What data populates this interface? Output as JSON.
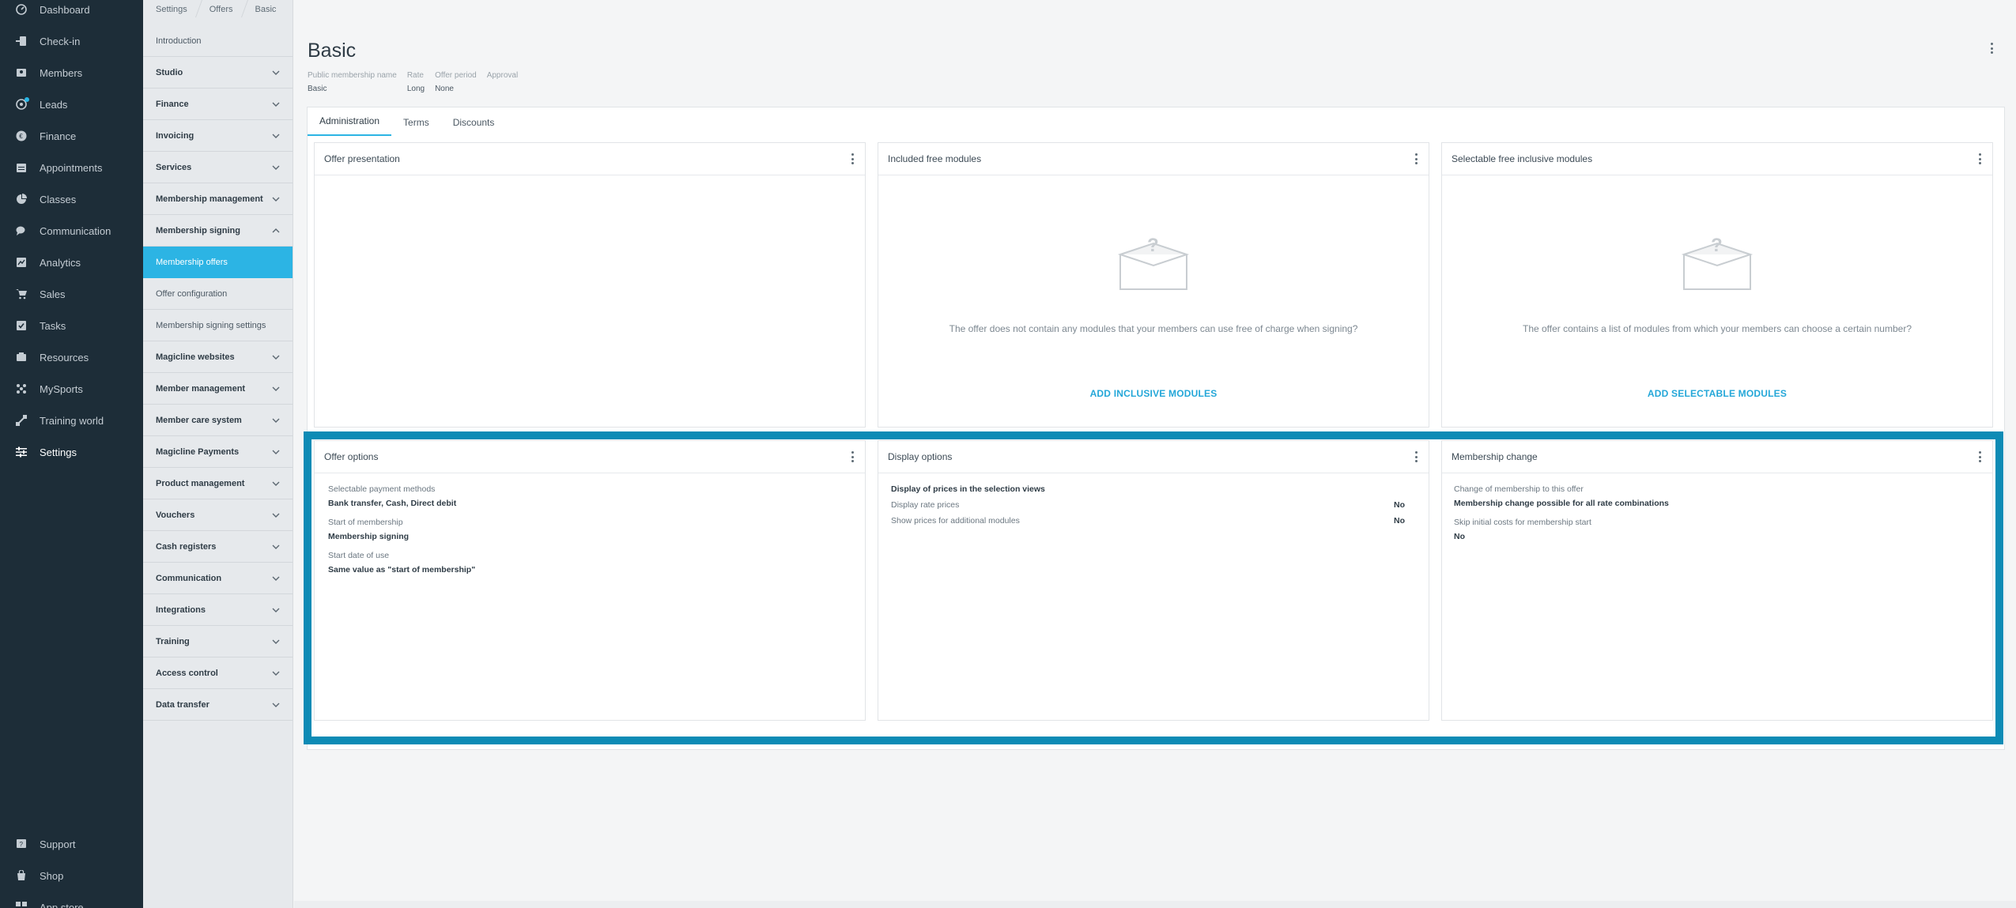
{
  "app_nav": {
    "items": [
      {
        "label": "Dashboard",
        "icon": "dashboard-icon"
      },
      {
        "label": "Check-in",
        "icon": "check-in-icon"
      },
      {
        "label": "Members",
        "icon": "members-icon"
      },
      {
        "label": "Leads",
        "icon": "leads-icon"
      },
      {
        "label": "Finance",
        "icon": "finance-icon"
      },
      {
        "label": "Appointments",
        "icon": "calendar-icon"
      },
      {
        "label": "Classes",
        "icon": "classes-icon"
      },
      {
        "label": "Communication",
        "icon": "chat-icon"
      },
      {
        "label": "Analytics",
        "icon": "analytics-icon"
      },
      {
        "label": "Sales",
        "icon": "cart-icon"
      },
      {
        "label": "Tasks",
        "icon": "tasks-icon"
      },
      {
        "label": "Resources",
        "icon": "resources-icon"
      },
      {
        "label": "MySports",
        "icon": "mysports-icon"
      },
      {
        "label": "Training world",
        "icon": "training-icon"
      },
      {
        "label": "Settings",
        "icon": "settings-sliders-icon"
      }
    ],
    "bottom_items": [
      {
        "label": "Support",
        "icon": "support-icon"
      },
      {
        "label": "Shop",
        "icon": "shop-icon"
      },
      {
        "label": "App store",
        "icon": "app-store-icon"
      }
    ],
    "active": "Settings"
  },
  "breadcrumb": [
    "Settings",
    "Offers",
    "Basic"
  ],
  "sub_nav": {
    "items": [
      {
        "label": "Introduction",
        "style": "plain"
      },
      {
        "label": "Studio",
        "style": "bold",
        "chevron": "down"
      },
      {
        "label": "Finance",
        "style": "bold",
        "chevron": "down"
      },
      {
        "label": "Invoicing",
        "style": "bold",
        "chevron": "down"
      },
      {
        "label": "Services",
        "style": "bold",
        "chevron": "down"
      },
      {
        "label": "Membership management",
        "style": "bold",
        "chevron": "down"
      },
      {
        "label": "Membership signing",
        "style": "bold",
        "chevron": "up"
      },
      {
        "label": "Membership offers",
        "style": "active"
      },
      {
        "label": "Offer configuration",
        "style": "plain"
      },
      {
        "label": "Membership signing settings",
        "style": "plain"
      },
      {
        "label": "Magicline websites",
        "style": "bold",
        "chevron": "down"
      },
      {
        "label": "Member management",
        "style": "bold",
        "chevron": "down"
      },
      {
        "label": "Member care system",
        "style": "bold",
        "chevron": "down"
      },
      {
        "label": "Magicline Payments",
        "style": "bold",
        "chevron": "down"
      },
      {
        "label": "Product management",
        "style": "bold",
        "chevron": "down"
      },
      {
        "label": "Vouchers",
        "style": "bold",
        "chevron": "down"
      },
      {
        "label": "Cash registers",
        "style": "bold",
        "chevron": "down"
      },
      {
        "label": "Communication",
        "style": "bold",
        "chevron": "down"
      },
      {
        "label": "Integrations",
        "style": "bold",
        "chevron": "down"
      },
      {
        "label": "Training",
        "style": "bold",
        "chevron": "down"
      },
      {
        "label": "Access control",
        "style": "bold",
        "chevron": "down"
      },
      {
        "label": "Data transfer",
        "style": "bold",
        "chevron": "down"
      }
    ]
  },
  "page": {
    "title": "Basic",
    "meta": [
      {
        "label": "Public membership name",
        "value": "Basic"
      },
      {
        "label": "Rate",
        "value": "Long"
      },
      {
        "label": "Offer period",
        "value": "None"
      },
      {
        "label": "Approval",
        "value": ""
      }
    ],
    "tabs": [
      "Administration",
      "Terms",
      "Discounts"
    ],
    "active_tab": "Administration"
  },
  "cards": {
    "offer_presentation": {
      "title": "Offer presentation"
    },
    "included_modules": {
      "title": "Included free modules",
      "empty_text": "The offer does not contain any modules that your members can use free of charge when signing?",
      "action": "ADD INCLUSIVE MODULES"
    },
    "selectable_modules": {
      "title": "Selectable free inclusive modules",
      "empty_text": "The offer contains a list of modules from which your members can choose a certain number?",
      "action": "ADD SELECTABLE MODULES"
    },
    "offer_options": {
      "title": "Offer options",
      "fields": [
        {
          "label": "Selectable payment methods",
          "value": "Bank transfer, Cash, Direct debit"
        },
        {
          "label": "Start of membership",
          "value": "Membership signing"
        },
        {
          "label": "Start date of use",
          "value": "Same value as \"start of membership\""
        }
      ]
    },
    "display_options": {
      "title": "Display options",
      "heading": "Display of prices in the selection views",
      "rows": [
        {
          "label": "Display rate prices",
          "value": "No"
        },
        {
          "label": "Show prices for additional modules",
          "value": "No"
        }
      ]
    },
    "membership_change": {
      "title": "Membership change",
      "fields": [
        {
          "label": "Change of membership to this offer",
          "value": "Membership change possible for all rate combinations"
        },
        {
          "label": "Skip initial costs for membership start",
          "value": "No"
        }
      ]
    }
  },
  "colors": {
    "accent": "#2cb4e4",
    "highlight": "#0d8bb5",
    "nav_bg": "#1d2d38"
  }
}
